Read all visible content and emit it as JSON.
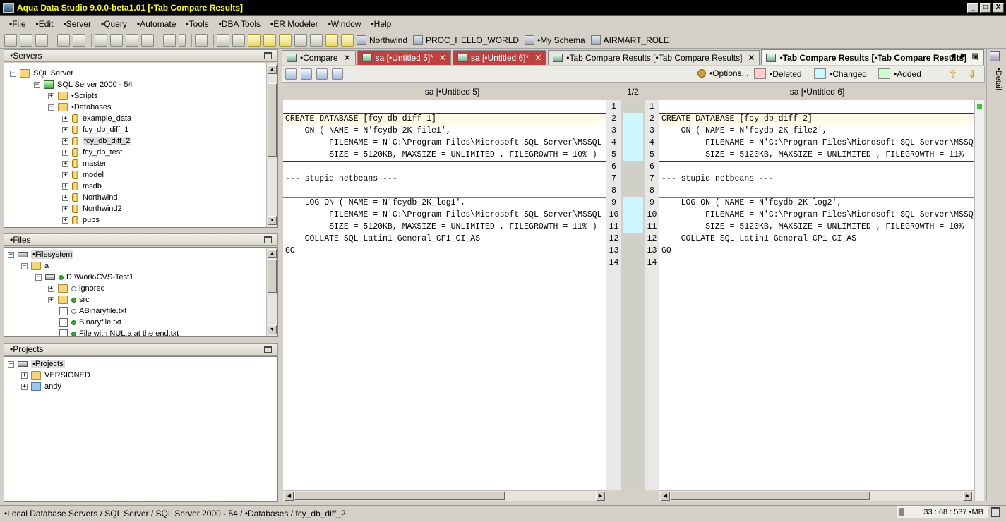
{
  "window": {
    "title": "Aqua Data Studio 9.0.0-beta1.01 [•Tab Compare Results]",
    "controls": [
      "_",
      "□",
      "X"
    ]
  },
  "menu": [
    "•File",
    "•Edit",
    "•Server",
    "•Query",
    "•Automate",
    "•Tools",
    "•DBA Tools",
    "•ER Modeler",
    "•Window",
    "•Help"
  ],
  "toolbar": {
    "connections": [
      "Northwind",
      "PROC_HELLO_WORLD",
      "•My Schema",
      "AIRMART_ROLE"
    ]
  },
  "servers_panel": {
    "title": "•Servers",
    "nodes": {
      "sqlserver": "SQL Server",
      "instance": "SQL Server 2000 - 54",
      "scripts": "•Scripts",
      "databases": "•Databases",
      "dbs": [
        "example_data",
        "fcy_db_diff_1",
        "fcy_db_diff_2",
        "fcy_db_test",
        "master",
        "model",
        "msdb",
        "Northwind",
        "Northwind2",
        "pubs"
      ]
    }
  },
  "files_panel": {
    "title": "•Files",
    "nodes": {
      "filesystem": "•Filesystem",
      "a": "a",
      "workdir": "D:\\Work\\CVS-Test1",
      "ignored": "ignored",
      "src": "src",
      "file1": "ABinaryfile.txt",
      "file2": "Binaryfile.txt",
      "file3": "File with NUL,a at the end.txt"
    }
  },
  "projects_panel": {
    "title": "•Projects",
    "nodes": {
      "projects": "•Projects",
      "versioned": "VERSIONED",
      "andy": "andy"
    }
  },
  "tabs": [
    {
      "label": "•Compare",
      "close": "✕"
    },
    {
      "label": "sa [•Untitled 5]*",
      "close": "✕"
    },
    {
      "label": "sa [•Untitled 6]*",
      "close": "✕"
    },
    {
      "label": "•Tab Compare Results [•Tab Compare Results]",
      "close": "✕"
    },
    {
      "label": "•Tab Compare Results [•Tab Compare Results]",
      "close": "✕"
    }
  ],
  "compare_toolbar": {
    "options": "•Options...",
    "deleted": "•Deleted",
    "changed": "•Changed",
    "added": "•Added",
    "colors": {
      "deleted": "#ffcccc",
      "changed": "#ccf7ff",
      "added": "#ccffcc"
    }
  },
  "compare": {
    "left_title": "sa [•Untitled 5]",
    "right_title": "sa [•Untitled 6]",
    "diff_position": "1/2",
    "line_numbers": [
      "1",
      "2",
      "3",
      "4",
      "5",
      "6",
      "7",
      "8",
      "9",
      "10",
      "11",
      "12",
      "13",
      "14"
    ],
    "left_lines": [
      "",
      "CREATE DATABASE [fcy_db_diff_1]",
      "    ON ( NAME = N'fcydb_2K_file1',",
      "         FILENAME = N'C:\\Program Files\\Microsoft SQL Server\\MSSQL",
      "         SIZE = 5120KB, MAXSIZE = UNLIMITED , FILEGROWTH = 10% )",
      "",
      "--- stupid netbeans ---",
      "",
      "    LOG ON ( NAME = N'fcydb_2K_log1',",
      "         FILENAME = N'C:\\Program Files\\Microsoft SQL Server\\MSSQL",
      "         SIZE = 5120KB, MAXSIZE = UNLIMITED , FILEGROWTH = 11% )",
      "    COLLATE SQL_Latin1_General_CP1_CI_AS",
      "GO",
      ""
    ],
    "right_lines": [
      "",
      "CREATE DATABASE [fcy_db_diff_2]",
      "    ON ( NAME = N'fcydb_2K_file2',",
      "         FILENAME = N'C:\\Program Files\\Microsoft SQL Server\\MSSQ",
      "         SIZE = 5120KB, MAXSIZE = UNLIMITED , FILEGROWTH = 11%",
      "",
      "--- stupid netbeans ---",
      "",
      "    LOG ON ( NAME = N'fcydb_2K_log2',",
      "         FILENAME = N'C:\\Program Files\\Microsoft SQL Server\\MSSQ",
      "         SIZE = 5120KB, MAXSIZE = UNLIMITED , FILEGROWTH = 10%",
      "    COLLATE SQL_Latin1_General_CP1_CI_AS",
      "GO",
      ""
    ]
  },
  "side_strip": {
    "detail": "•Detail"
  },
  "statusbar": {
    "path": "•Local Database Servers / SQL Server / SQL Server 2000 - 54 / •Databases / fcy_db_diff_2",
    "memory": "33 : 68 : 537 •MB"
  }
}
